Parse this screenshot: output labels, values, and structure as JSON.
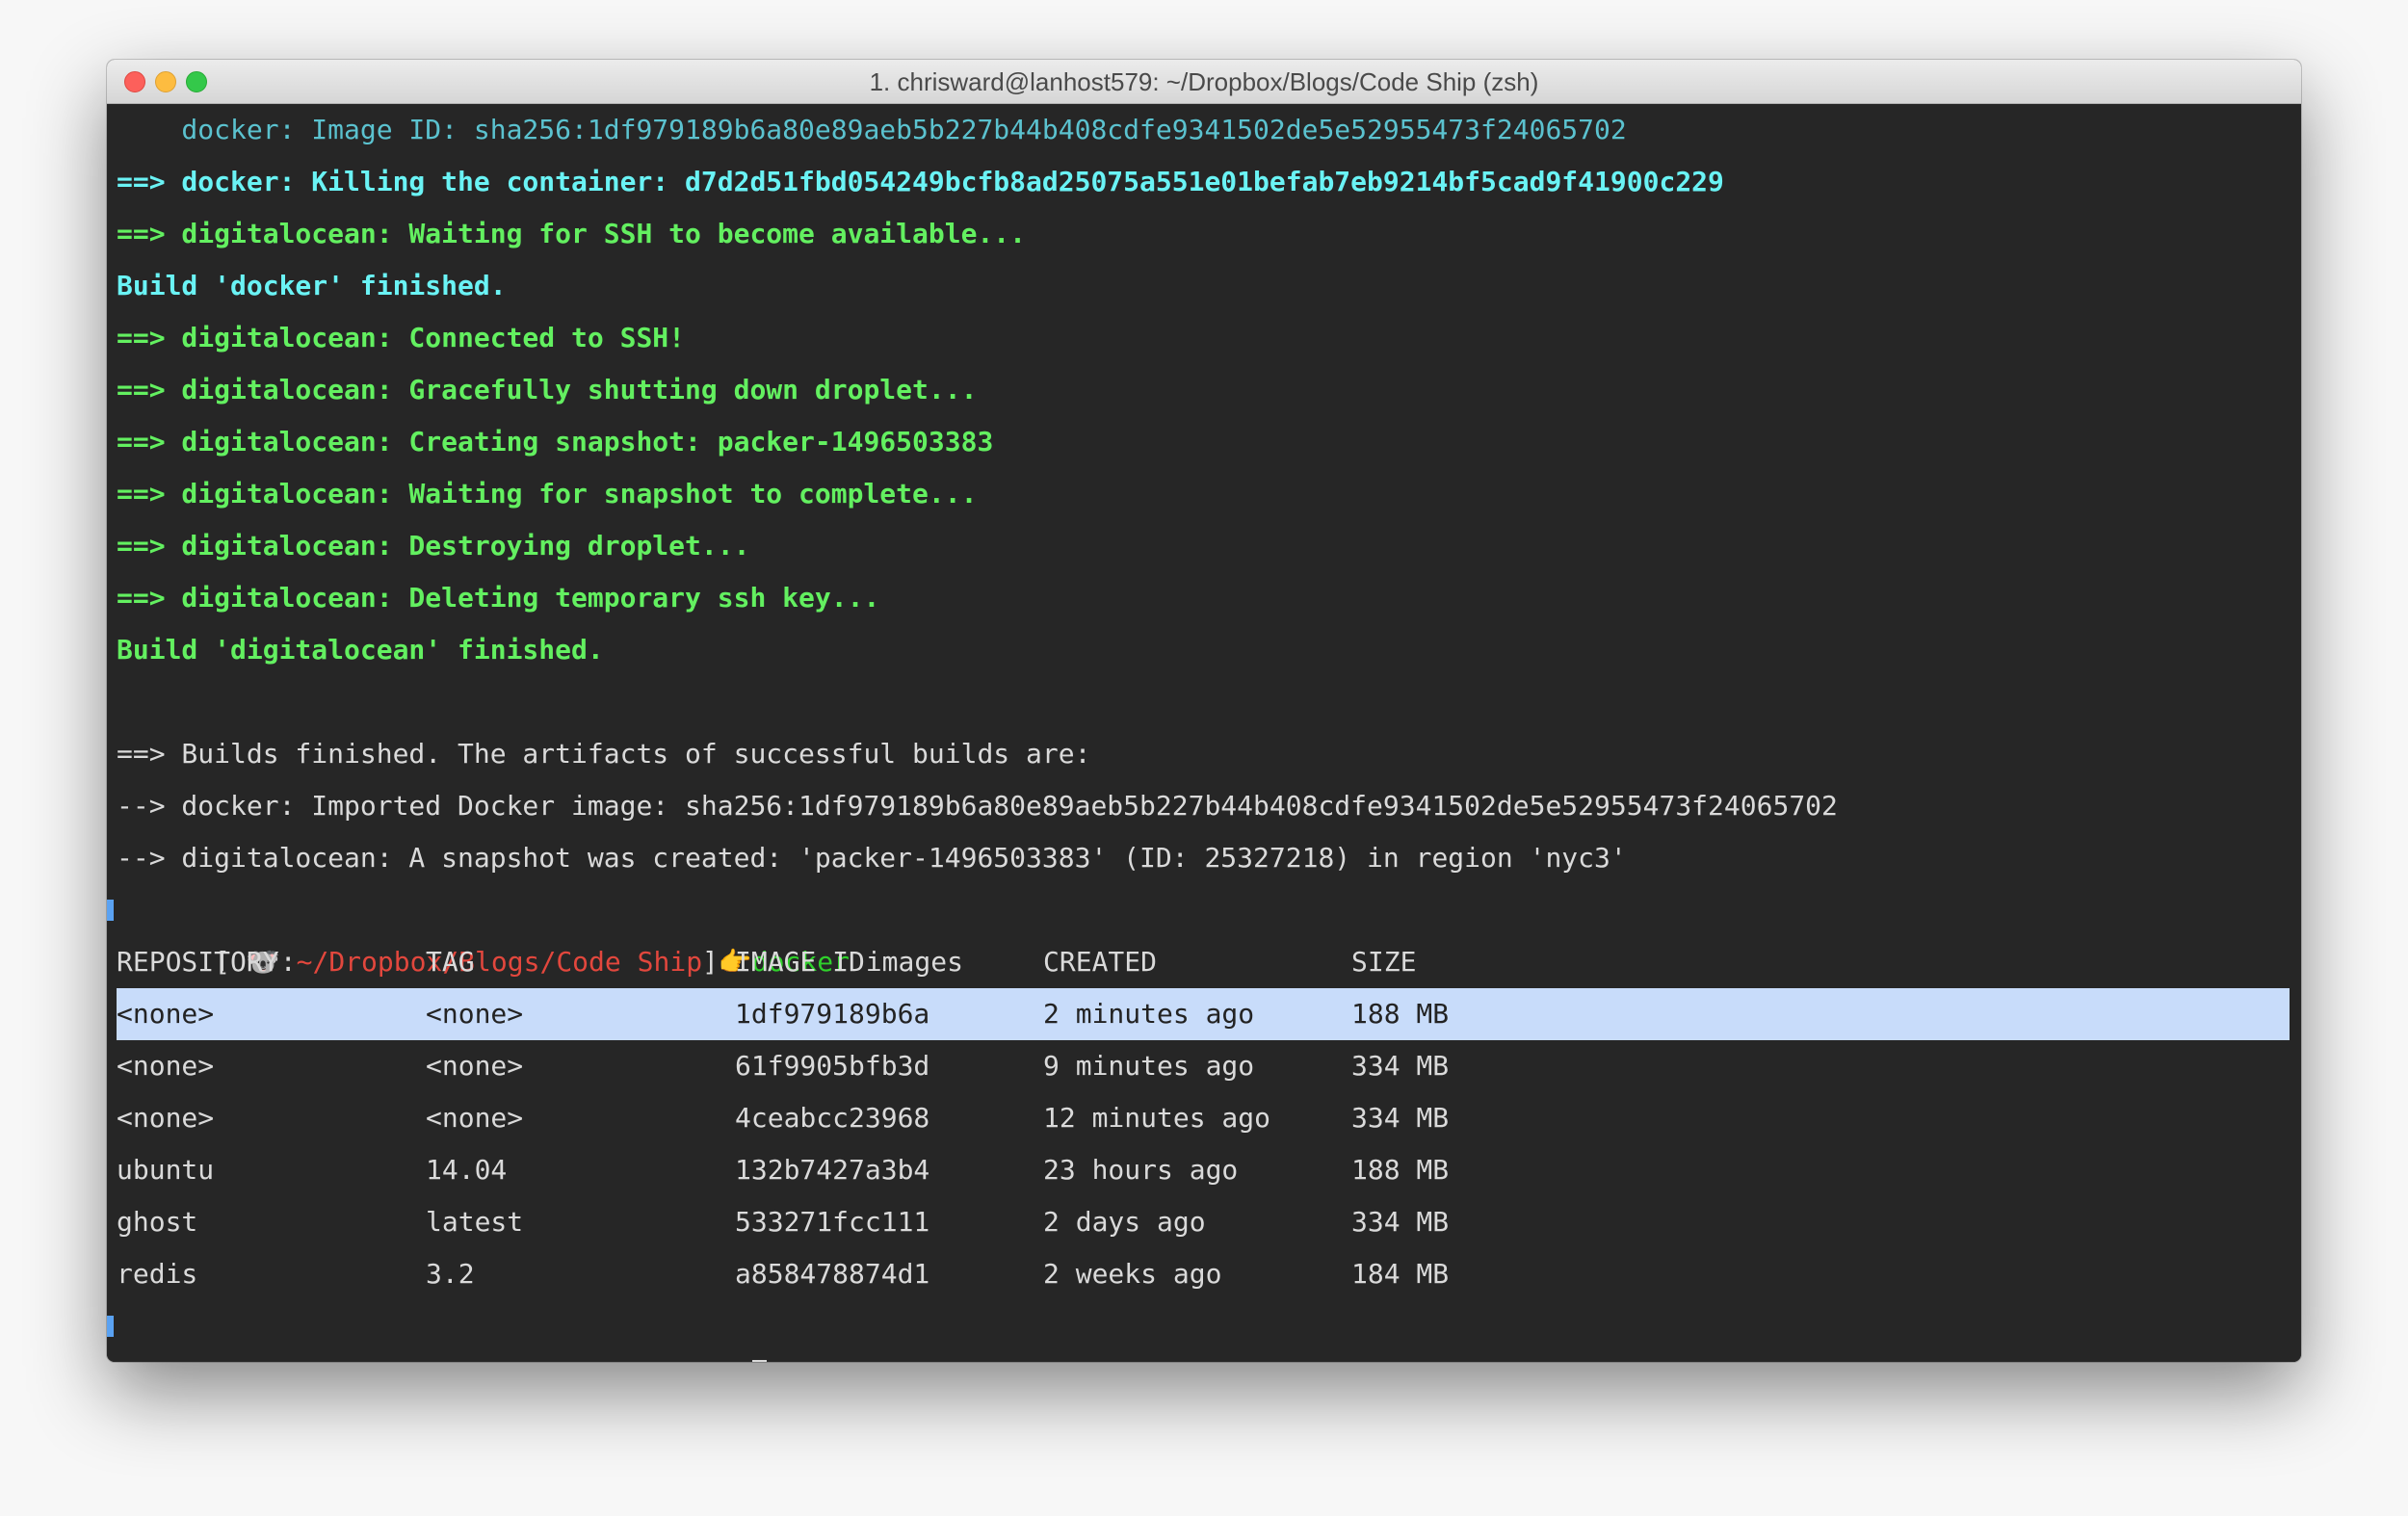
{
  "window": {
    "title": "1. chrisward@lanhost579: ~/Dropbox/Blogs/Code Ship (zsh)"
  },
  "output": {
    "l1": "    docker: Image ID: sha256:1df979189b6a80e89aeb5b227b44b408cdfe9341502de5e52955473f24065702",
    "l2": "==> docker: Killing the container: d7d2d51fbd054249bcfb8ad25075a551e01befab7eb9214bf5cad9f41900c229",
    "l3": "==> digitalocean: Waiting for SSH to become available...",
    "l4": "Build 'docker' finished.",
    "l5": "==> digitalocean: Connected to SSH!",
    "l6": "==> digitalocean: Gracefully shutting down droplet...",
    "l7": "==> digitalocean: Creating snapshot: packer-1496503383",
    "l8": "==> digitalocean: Waiting for snapshot to complete...",
    "l9": "==> digitalocean: Destroying droplet...",
    "l10": "==> digitalocean: Deleting temporary ssh key...",
    "l11": "Build 'digitalocean' finished.",
    "l12": "==> Builds finished. The artifacts of successful builds are:",
    "l13": "--> docker: Imported Docker image: sha256:1df979189b6a80e89aeb5b227b44b408cdfe9341502de5e52955473f24065702",
    "l14": "--> digitalocean: A snapshot was created: 'packer-1496503383' (ID: 25327218) in region 'nyc3'"
  },
  "prompt": {
    "open": "[ ",
    "emoji": "🐨",
    "colon": ":",
    "path": "~/Dropbox/Blogs/Code Ship",
    "close": "]",
    "finger": "👉",
    "command_bin": "docker",
    "command_args": " images"
  },
  "table": {
    "headers": [
      "REPOSITORY",
      "TAG",
      "IMAGE ID",
      "CREATED",
      "SIZE"
    ],
    "rows": [
      [
        "<none>",
        "<none>",
        "1df979189b6a",
        "2 minutes ago",
        "188 MB"
      ],
      [
        "<none>",
        "<none>",
        "61f9905bfb3d",
        "9 minutes ago",
        "334 MB"
      ],
      [
        "<none>",
        "<none>",
        "4ceabcc23968",
        "12 minutes ago",
        "334 MB"
      ],
      [
        "ubuntu",
        "14.04",
        "132b7427a3b4",
        "23 hours ago",
        "188 MB"
      ],
      [
        "ghost",
        "latest",
        "533271fcc111",
        "2 days ago",
        "334 MB"
      ],
      [
        "redis",
        "3.2",
        "a858478874d1",
        "2 weeks ago",
        "184 MB"
      ]
    ]
  },
  "colors": {
    "background": "#262626",
    "cyan": "#6af3f5",
    "green": "#63f060",
    "path_red": "#e2473d",
    "selection": "#c8dcfa"
  }
}
